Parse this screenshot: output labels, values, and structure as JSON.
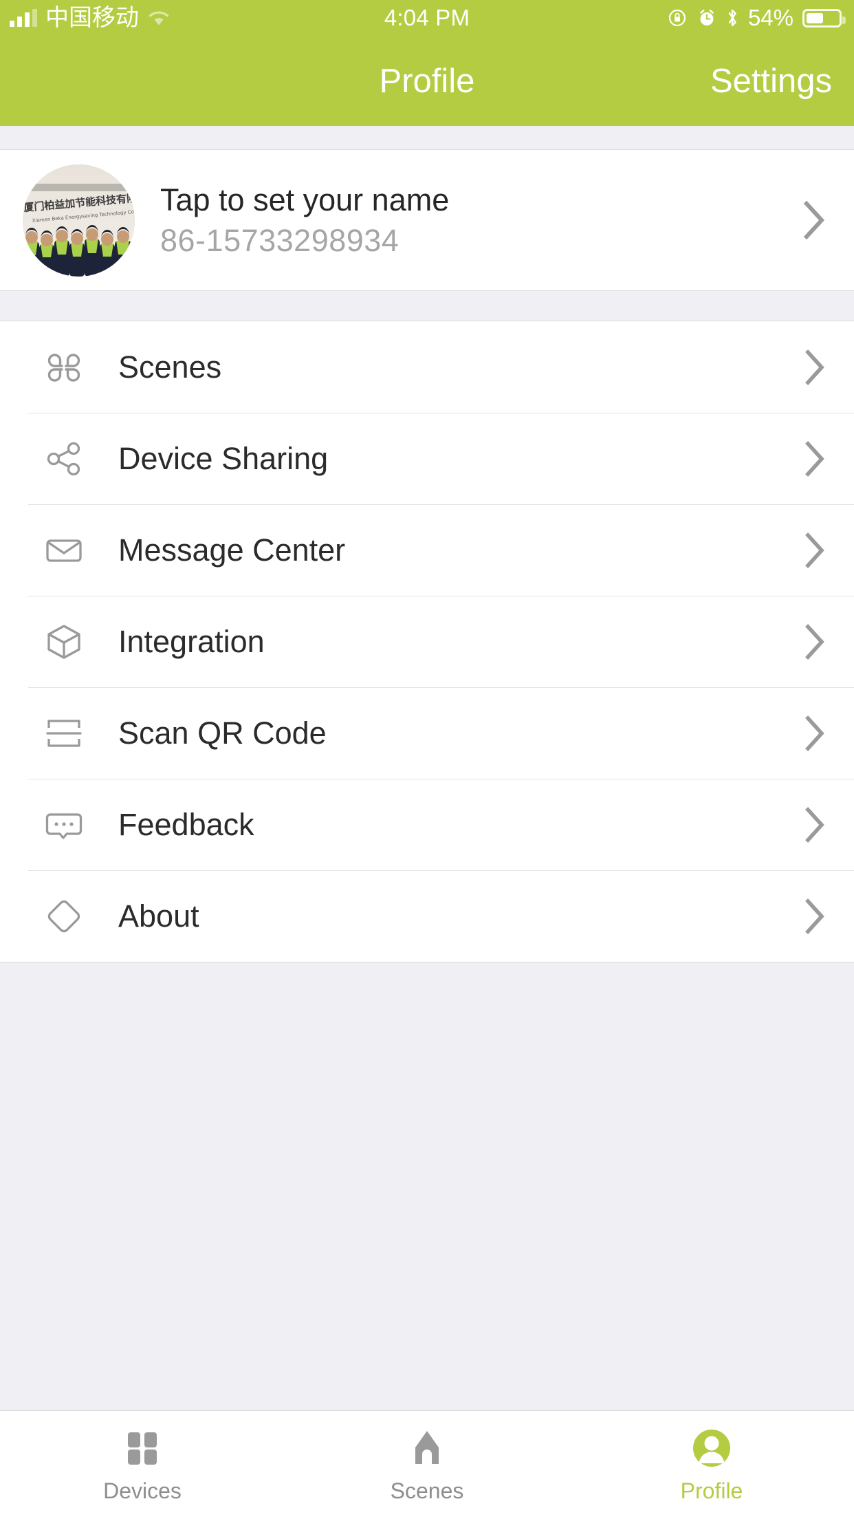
{
  "theme": {
    "accent": "#b3cc42",
    "page_bg": "#efeff4",
    "card_bg": "#ffffff",
    "text_primary": "#2b2b2b",
    "text_muted": "#a6a6a6",
    "icon_gray": "#9a9a9a",
    "separator": "#e2e2e3"
  },
  "statusbar": {
    "carrier": "中国移动",
    "signal_icon": "cellular-signal-icon",
    "wifi_icon": "wifi-icon",
    "time": "4:04 PM",
    "rotation_lock_icon": "rotation-lock-icon",
    "alarm_icon": "alarm-clock-icon",
    "bluetooth_icon": "bluetooth-icon",
    "battery_percent": "54%",
    "battery_level": 54,
    "battery_icon": "battery-icon"
  },
  "navbar": {
    "title": "Profile",
    "right_action": "Settings"
  },
  "profile": {
    "avatar_icon": "user-avatar-photo",
    "name": "Tap to set your name",
    "phone": "86-15733298934",
    "chevron_icon": "chevron-right-icon"
  },
  "menu": {
    "items": [
      {
        "label": "Scenes",
        "icon": "clover-grid-icon",
        "chevron": "chevron-right-icon"
      },
      {
        "label": "Device Sharing",
        "icon": "share-nodes-icon",
        "chevron": "chevron-right-icon"
      },
      {
        "label": "Message Center",
        "icon": "envelope-icon",
        "chevron": "chevron-right-icon"
      },
      {
        "label": "Integration",
        "icon": "cube-3d-icon",
        "chevron": "chevron-right-icon"
      },
      {
        "label": "Scan QR Code",
        "icon": "scan-code-icon",
        "chevron": "chevron-right-icon"
      },
      {
        "label": "Feedback",
        "icon": "speech-bubble-icon",
        "chevron": "chevron-right-icon"
      },
      {
        "label": "About",
        "icon": "diamond-icon",
        "chevron": "chevron-right-icon"
      }
    ]
  },
  "tabbar": {
    "tabs": [
      {
        "label": "Devices",
        "icon": "grid-squares-icon",
        "active": false
      },
      {
        "label": "Scenes",
        "icon": "home-icon",
        "active": false
      },
      {
        "label": "Profile",
        "icon": "person-circle-icon",
        "active": true
      }
    ]
  }
}
